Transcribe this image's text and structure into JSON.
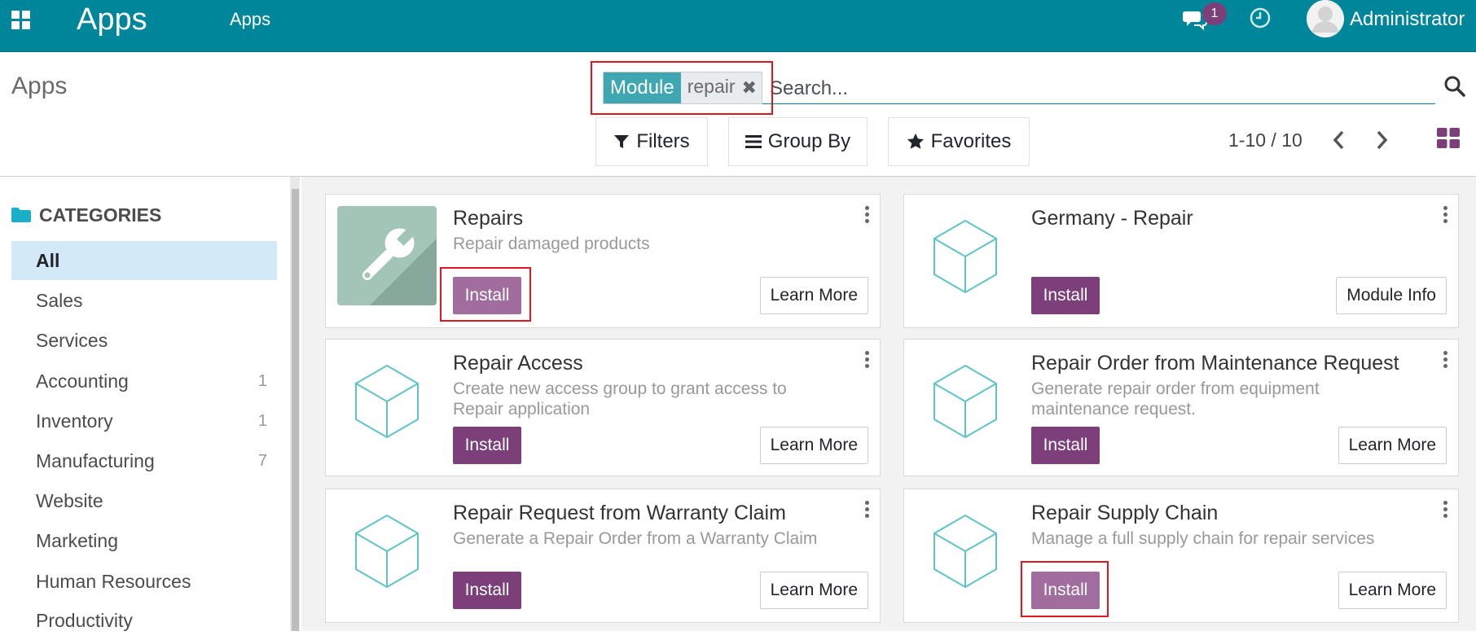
{
  "navbar": {
    "brand": "Apps",
    "menu_item": "Apps",
    "chat_badge": "1",
    "user_name": "Administrator"
  },
  "control_panel": {
    "title": "Apps",
    "facet_label": "Module",
    "facet_value": "repair",
    "search_placeholder": "Search...",
    "filters_label": "Filters",
    "group_by_label": "Group By",
    "favorites_label": "Favorites",
    "pager_value": "1-10 / 10"
  },
  "sidebar": {
    "header": "CATEGORIES",
    "items": [
      {
        "label": "All",
        "count": ""
      },
      {
        "label": "Sales",
        "count": ""
      },
      {
        "label": "Services",
        "count": ""
      },
      {
        "label": "Accounting",
        "count": "1"
      },
      {
        "label": "Inventory",
        "count": "1"
      },
      {
        "label": "Manufacturing",
        "count": "7"
      },
      {
        "label": "Website",
        "count": ""
      },
      {
        "label": "Marketing",
        "count": ""
      },
      {
        "label": "Human Resources",
        "count": ""
      },
      {
        "label": "Productivity",
        "count": ""
      }
    ]
  },
  "apps": [
    {
      "name": "Repairs",
      "summary": "Repair damaged products",
      "install": "Install",
      "secondary": "Learn More",
      "icon": "wrench-icon"
    },
    {
      "name": "Germany - Repair",
      "summary": "",
      "install": "Install",
      "secondary": "Module Info",
      "icon": "module-cube-icon"
    },
    {
      "name": "Repair Access",
      "summary": "Create new access group to grant access to Repair application",
      "install": "Install",
      "secondary": "Learn More",
      "icon": "module-cube-icon"
    },
    {
      "name": "Repair Order from Maintenance Request",
      "summary": "Generate repair order from equipment maintenance request.",
      "install": "Install",
      "secondary": "Learn More",
      "icon": "module-cube-icon"
    },
    {
      "name": "Repair Request from Warranty Claim",
      "summary": "Generate a Repair Order from a Warranty Claim",
      "install": "Install",
      "secondary": "Learn More",
      "icon": "module-cube-icon"
    },
    {
      "name": "Repair Supply Chain",
      "summary": "Manage a full supply chain for repair services",
      "install": "Install",
      "secondary": "Learn More",
      "icon": "module-cube-icon"
    }
  ],
  "colors": {
    "navbar": "#00869a",
    "install_button": "#7c3f7a",
    "highlight_border": "#e0171f",
    "active_category": "#d4e9f7"
  }
}
